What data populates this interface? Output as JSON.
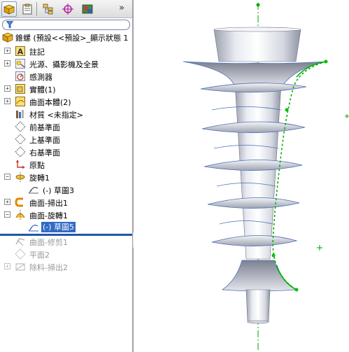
{
  "toolbar": {
    "tabs": [
      "feature-manager-icon",
      "property-manager-icon",
      "configuration-manager-icon",
      "dimxpert-icon",
      "display-manager-icon"
    ],
    "more": "»"
  },
  "tree": {
    "root": "錐螺 (預設<<預設>_顯示狀態 1",
    "items": [
      {
        "label": "註記",
        "icon": "annotations-icon"
      },
      {
        "label": "光源、攝影機及全景",
        "icon": "lights-cameras-icon"
      },
      {
        "label": "感測器",
        "icon": "sensors-icon"
      },
      {
        "label": "實體(1)",
        "icon": "solid-bodies-icon"
      },
      {
        "label": "曲面本體(2)",
        "icon": "surface-bodies-icon"
      },
      {
        "label": "材質 <未指定>",
        "icon": "material-icon"
      },
      {
        "label": "前基準面",
        "icon": "plane-icon"
      },
      {
        "label": "上基準面",
        "icon": "plane-icon"
      },
      {
        "label": "右基準面",
        "icon": "plane-icon"
      },
      {
        "label": "原點",
        "icon": "origin-icon"
      },
      {
        "label": "旋轉1",
        "icon": "revolve-icon"
      },
      {
        "label": "(-) 草圖3",
        "icon": "sketch-icon"
      },
      {
        "label": "曲面-掃出1",
        "icon": "surface-sweep-icon"
      },
      {
        "label": "曲面-旋轉1",
        "icon": "surface-revolve-icon"
      },
      {
        "label": "(-) 草圖5",
        "icon": "sketch-icon"
      },
      {
        "label": "曲面-修剪1",
        "icon": "surface-trim-icon"
      },
      {
        "label": "平面2",
        "icon": "plane-icon"
      },
      {
        "label": "除料-掃出2",
        "icon": "cut-sweep-icon"
      }
    ]
  },
  "colors": {
    "selection": "#316ac5",
    "rollback_bar": "#2156a8",
    "sketch_green": "#00b000",
    "model_gray": "#c4c8d4"
  }
}
